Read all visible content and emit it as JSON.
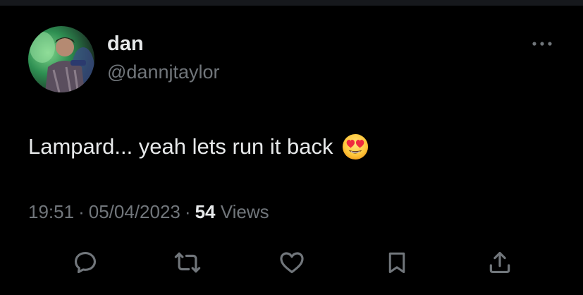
{
  "tweet": {
    "author": {
      "display_name": "dan",
      "handle": "@dannjtaylor",
      "avatar": "profile-photo"
    },
    "text": "Lampard... yeah lets run it back",
    "emoji": "smiling-face-with-heart-eyes",
    "time": "19:51",
    "date": "05/04/2023",
    "separator": "·",
    "views_count": "54",
    "views_label": "Views"
  },
  "actions": [
    {
      "name": "reply",
      "icon": "reply-icon"
    },
    {
      "name": "retweet",
      "icon": "retweet-icon"
    },
    {
      "name": "like",
      "icon": "heart-icon"
    },
    {
      "name": "bookmark",
      "icon": "bookmark-icon"
    },
    {
      "name": "share",
      "icon": "share-icon"
    }
  ],
  "colors": {
    "background": "#000000",
    "primary_text": "#e7e9ea",
    "secondary_text": "#71767b"
  }
}
